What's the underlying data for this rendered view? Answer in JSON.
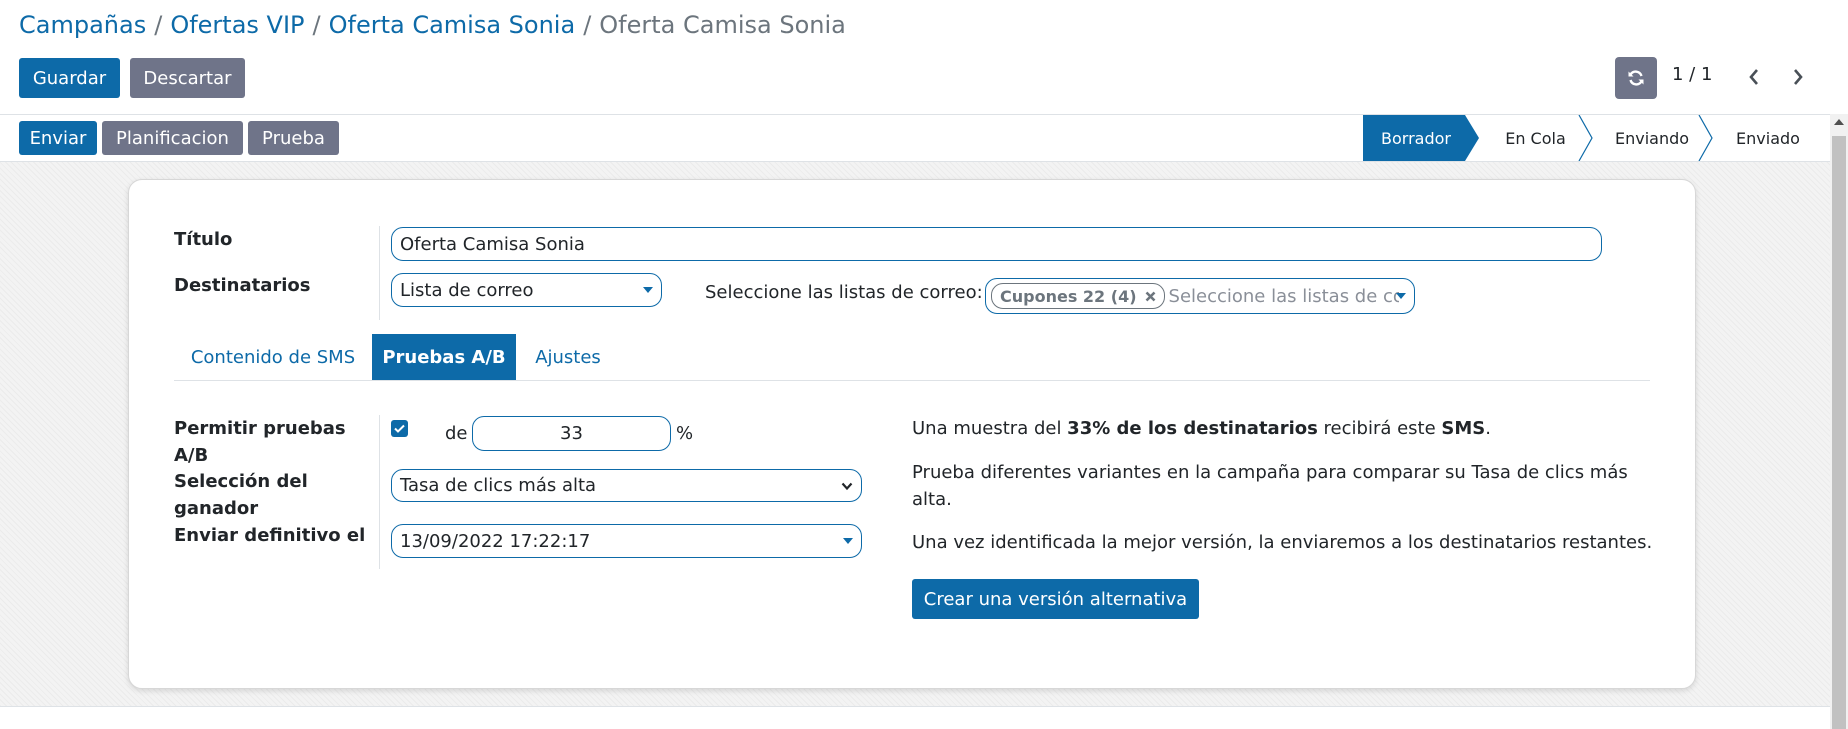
{
  "breadcrumb": {
    "item1": "Campañas",
    "item2": "Ofertas VIP",
    "item3": "Oferta Camisa Sonia",
    "current": "Oferta Camisa Sonia",
    "separator": "/"
  },
  "form_buttons": {
    "save": "Guardar",
    "discard": "Descartar"
  },
  "pager": {
    "value": "1 / 1"
  },
  "header_buttons": {
    "send": "Enviar",
    "schedule": "Planificacion",
    "test": "Prueba"
  },
  "status_steps": [
    "Borrador",
    "En Cola",
    "Enviando",
    "Enviado"
  ],
  "status_active": "Borrador",
  "form": {
    "title_label": "Título",
    "title_value": "Oferta Camisa Sonia",
    "recipients_label": "Destinatarios",
    "recipients_value": "Lista de correo",
    "mailing_lists_label": "Seleccione las listas de correo:",
    "mailing_list_tag": "Cupones 22 (4)",
    "mailing_list_placeholder": "Seleccione las listas de co"
  },
  "tabs": [
    "Contenido de SMS",
    "Pruebas A/B",
    "Ajustes"
  ],
  "active_tab": "Pruebas A/B",
  "ab": {
    "allow_label_1": "Permitir pruebas",
    "allow_label_2": "A/B",
    "allow_checked": true,
    "of_label": "de",
    "percent_value": "33",
    "percent_sign": "%",
    "winner_label_1": "Selección del",
    "winner_label_2": "ganador",
    "winner_value": "Tasa de clics más alta",
    "send_final_label": "Enviar definitivo el",
    "send_final_value": "13/09/2022 17:22:17",
    "info1_pre": "Una muestra del ",
    "info1_bold": "33% de los destinatarios",
    "info1_mid": " recibirá este ",
    "info1_bold2": "SMS",
    "info1_end": ".",
    "info2_line1": "Prueba diferentes variantes en la campaña para comparar su Tasa de clics más",
    "info2_line2": "alta.",
    "info3": "Una vez identificada la mejor versión, la enviaremos a los destinatarios restantes.",
    "create_button": "Crear una versión alternativa"
  },
  "colors": {
    "primary": "#0d6aa8",
    "secondary": "#6f7489",
    "muted": "#6c757d"
  },
  "icons": {
    "refresh": "refresh-icon",
    "prev": "chevron-left-icon",
    "next": "chevron-right-icon",
    "check": "check-icon",
    "remove_tag": "close-icon",
    "dropdown": "caret-down-icon"
  }
}
